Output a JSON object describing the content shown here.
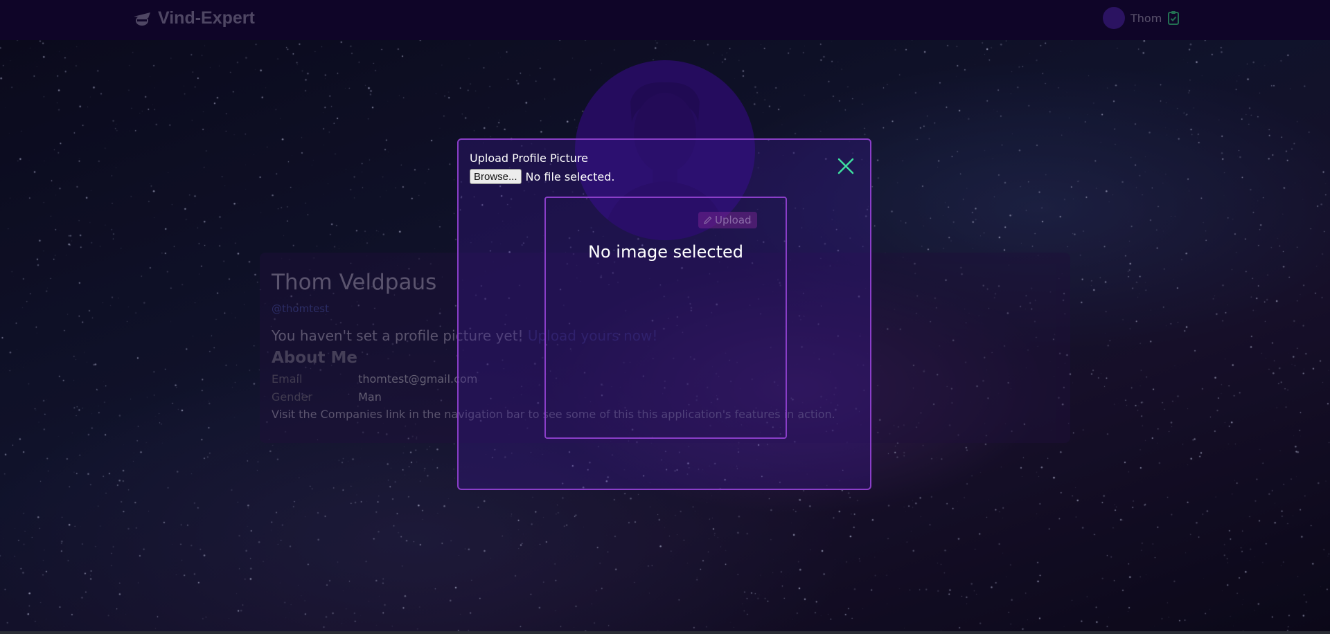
{
  "navbar": {
    "brand": "Vind-Expert",
    "user_name": "Thom"
  },
  "profile": {
    "name": "Thom Veldpaus",
    "handle": "@thomtest",
    "notice": "You haven't set a profile picture yet!",
    "notice_link": "Upload yours now!",
    "about_heading": "About Me",
    "email_label": "Email",
    "email_value": "thomtest@gmail.com",
    "gender_label": "Gender",
    "gender_value": "Man",
    "footer_text": "Visit the Companies link in the navigation bar to see some of this this application's features in action."
  },
  "modal": {
    "title": "Upload Profile Picture",
    "browse_label": "Browse...",
    "file_status": "No file selected.",
    "upload_label": "Upload",
    "preview_text": "No image selected",
    "close_icon": "close-icon"
  },
  "colors": {
    "accent": "#8a3ec8",
    "close_icon": "#3fe0a0",
    "navbar_bg": "#12062e"
  }
}
